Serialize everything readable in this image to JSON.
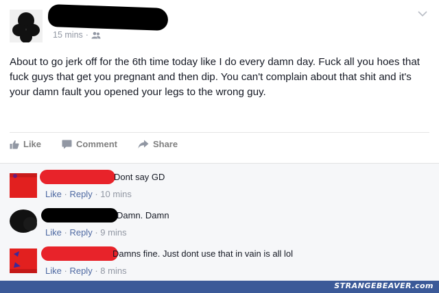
{
  "post": {
    "timestamp": "15 mins",
    "separator": "·",
    "audience_icon": "friends-icon",
    "body": "About to go jerk off for the 6th time today like I do every damn day. Fuck all you hoes that fuck guys that get you pregnant and then dip. You can't complain about that shit and it's your damn fault you opened your legs to the wrong guy.",
    "actions": {
      "like": "Like",
      "comment": "Comment",
      "share": "Share"
    }
  },
  "comments": [
    {
      "text": "Dont say GD",
      "like": "Like",
      "reply": "Reply",
      "sep": "·",
      "time": "10 mins"
    },
    {
      "text": "Damn. Damn",
      "like": "Like",
      "reply": "Reply",
      "sep": "·",
      "time": "9 mins"
    },
    {
      "text": "Damns fine. Just dont use that in vain is all lol",
      "like": "Like",
      "reply": "Reply",
      "sep": "·",
      "time": "8 mins"
    }
  ],
  "footer": {
    "watermark": "STRANGEBEAVER.com",
    "color": "#3b5998"
  },
  "colors": {
    "link": "#4e69a2",
    "meta": "#9197a3",
    "redact_red": "#e8232a"
  }
}
